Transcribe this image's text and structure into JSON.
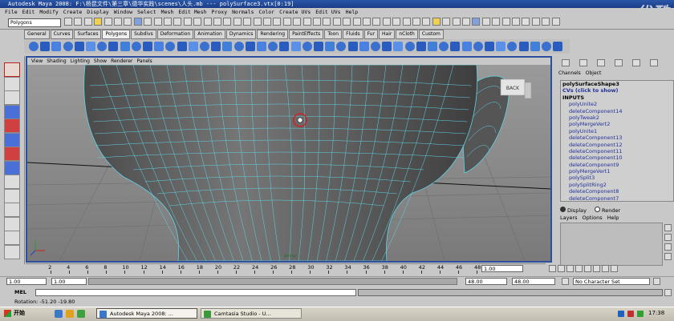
{
  "window": {
    "title": "Autodesk Maya 2008: F:\\杨昆文件\\第三章\\德华实践\\scenes\\人头.mb  ---  polySurface3.vtx[0:19]",
    "watermark": "优酷"
  },
  "menus": [
    "File",
    "Edit",
    "Modify",
    "Create",
    "Display",
    "Window",
    "Select",
    "Mesh",
    "Edit Mesh",
    "Proxy",
    "Normals",
    "Color",
    "Create UVs",
    "Edit UVs",
    "Help"
  ],
  "status_line": {
    "mode_select": "Polygons"
  },
  "shelf_tabs": [
    {
      "label": "General"
    },
    {
      "label": "Curves"
    },
    {
      "label": "Surfaces"
    },
    {
      "label": "Polygons",
      "active": true
    },
    {
      "label": "Subdivs"
    },
    {
      "label": "Deformation"
    },
    {
      "label": "Animation"
    },
    {
      "label": "Dynamics"
    },
    {
      "label": "Rendering"
    },
    {
      "label": "PaintEffects"
    },
    {
      "label": "Toon"
    },
    {
      "label": "Fluids"
    },
    {
      "label": "Fur"
    },
    {
      "label": "Hair"
    },
    {
      "label": "nCloth"
    },
    {
      "label": "Custom"
    }
  ],
  "viewport": {
    "panel_menus": [
      "View",
      "Shading",
      "Lighting",
      "Show",
      "Renderer",
      "Panels"
    ],
    "view_cube_label": "BACK",
    "camera_label": "persp"
  },
  "channel_box": {
    "tabs": [
      "Channels",
      "Object"
    ],
    "items": [
      {
        "label": "polySurfaceShape3",
        "style": "head"
      },
      {
        "label": "CVs (click to show)",
        "style": "sel"
      },
      {
        "label": "INPUTS",
        "style": "head"
      },
      {
        "label": "polyUnite2",
        "style": "sub"
      },
      {
        "label": "deleteComponent14",
        "style": "sub"
      },
      {
        "label": "polyTweak2",
        "style": "sub"
      },
      {
        "label": "polyMergeVert2",
        "style": "sub"
      },
      {
        "label": "polyUnite1",
        "style": "sub"
      },
      {
        "label": "deleteComponent13",
        "style": "sub"
      },
      {
        "label": "deleteComponent12",
        "style": "sub"
      },
      {
        "label": "deleteComponent11",
        "style": "sub"
      },
      {
        "label": "deleteComponent10",
        "style": "sub"
      },
      {
        "label": "deleteComponent9",
        "style": "sub"
      },
      {
        "label": "polyMergeVert1",
        "style": "sub"
      },
      {
        "label": "polySplit3",
        "style": "sub"
      },
      {
        "label": "polySplitRing2",
        "style": "sub"
      },
      {
        "label": "deleteComponent8",
        "style": "sub"
      },
      {
        "label": "deleteComponent7",
        "style": "sub"
      }
    ],
    "layer_options": [
      "Display",
      "Render"
    ],
    "layer_menus": [
      "Layers",
      "Options",
      "Help"
    ]
  },
  "time_slider": {
    "ticks": [
      "2",
      "4",
      "6",
      "8",
      "10",
      "12",
      "14",
      "16",
      "18",
      "20",
      "22",
      "24",
      "26",
      "28",
      "30",
      "32",
      "34",
      "36",
      "38",
      "40",
      "42",
      "44",
      "46",
      "48"
    ],
    "current_frame": "1.00"
  },
  "range_slider": {
    "start_time": "1.00",
    "playback_start": "1.00",
    "playback_end": "48.00",
    "end_time": "48.00",
    "character_set": "No Character Set"
  },
  "command_line": {
    "label": "MEL"
  },
  "help_line": {
    "text": "Rotation: -51.20   -19.80"
  },
  "taskbar": {
    "start_label": "开始",
    "tasks": [
      {
        "label": "Autodesk Maya 2008: ...",
        "active": true,
        "color": "#3a78c8"
      },
      {
        "label": "Camtasia Studio - U...",
        "active": false,
        "color": "#3a9a3a"
      }
    ],
    "clock": "17:38"
  },
  "colors": {
    "viewport_border": "#2e4e9e",
    "wire": "#5fd4e8",
    "mesh": "#6a6a6a"
  }
}
